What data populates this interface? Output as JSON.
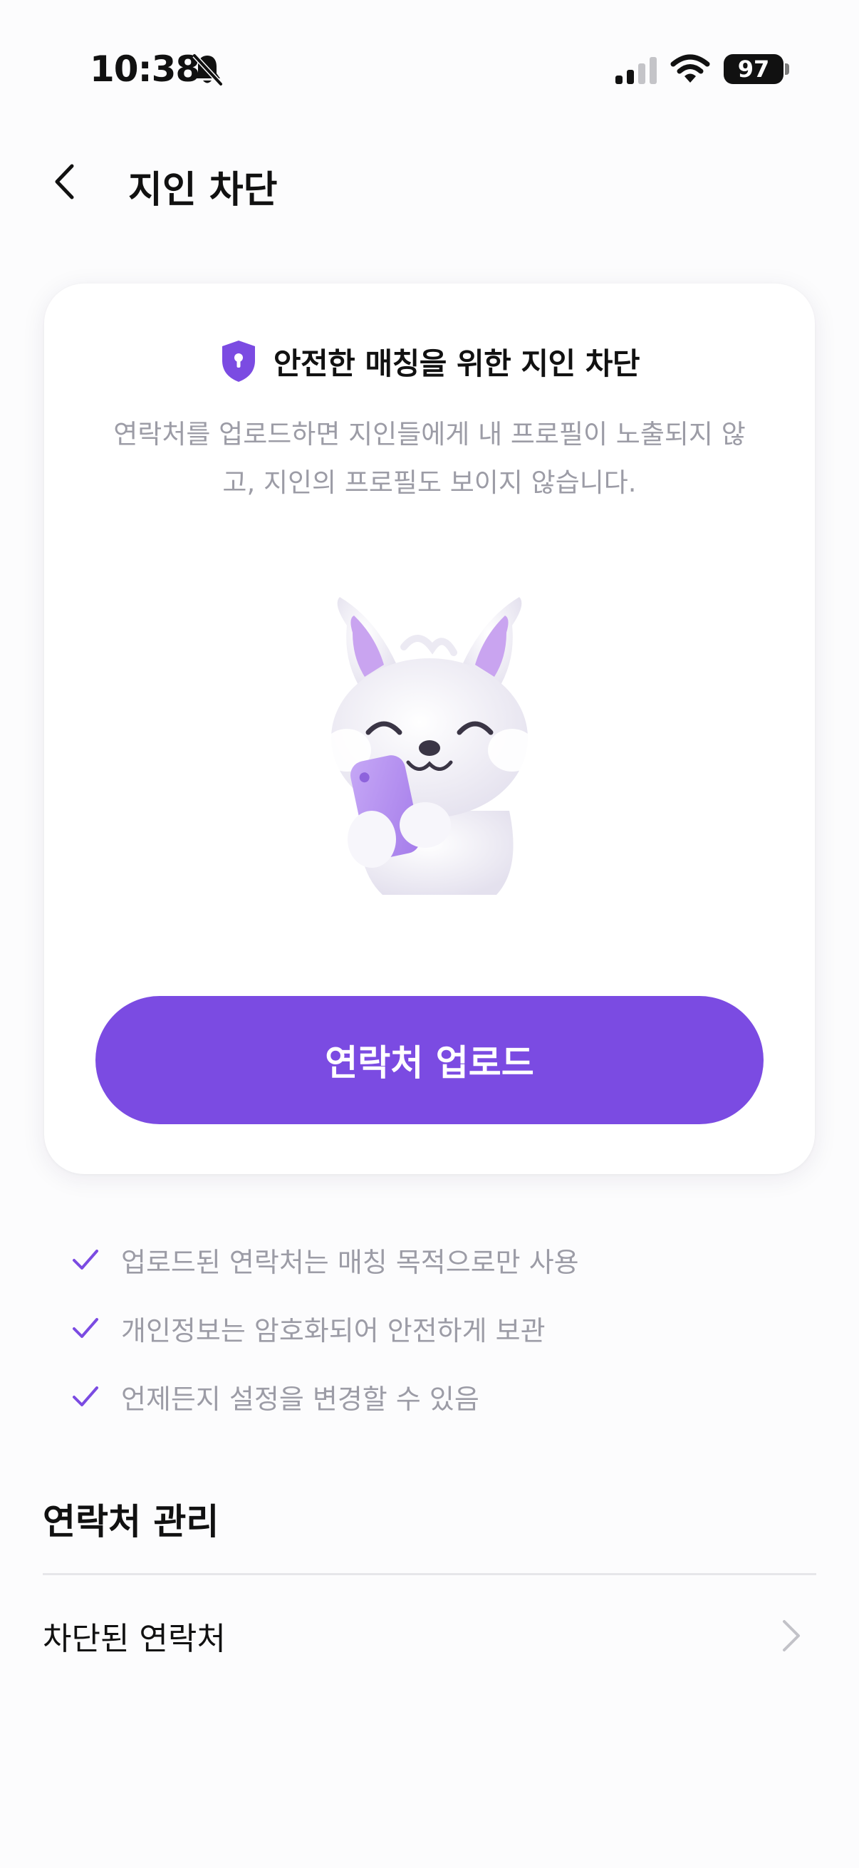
{
  "status_bar": {
    "time": "10:38",
    "battery": "97",
    "icons": [
      "bell-off-icon",
      "signal-icon",
      "wifi-icon",
      "battery-icon"
    ]
  },
  "header": {
    "title": "지인 차단",
    "back_icon": "chevron-left-icon"
  },
  "card": {
    "title": "안전한 매칭을 위한 지인 차단",
    "title_icon": "shield-lock-icon",
    "description": "연락처를 업로드하면 지인들에게 내 프로필이 노출되지 않고, 지인의 프로필도 보이지 않습니다.",
    "illustration": "fox-mascot-holding-phone",
    "button_label": "연락처 업로드"
  },
  "benefits": [
    "업로드된 연락처는 매칭 목적으로만 사용",
    "개인정보는 암호화되어 안전하게 보관",
    "언제든지 설정을 변경할 수 있음"
  ],
  "contacts_section": {
    "title": "연락처 관리",
    "items": [
      {
        "label": "차단된 연락처",
        "icon": "chevron-right-icon"
      }
    ]
  },
  "colors": {
    "accent": "#7B4BE2",
    "muted_text": "#9C9CA6",
    "background": "#FCFCFD",
    "card": "#FFFFFF"
  }
}
